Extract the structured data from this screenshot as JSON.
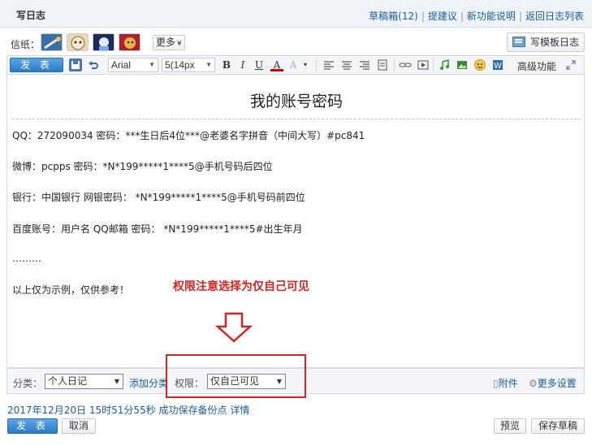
{
  "header": {
    "title": "写日志",
    "links": [
      "草稿箱(12)",
      "提建议",
      "新功能说明",
      "返回日志列表"
    ]
  },
  "stationery": {
    "label": "信纸：",
    "more_label": "更多",
    "template_label": "写模板日志"
  },
  "toolbar": {
    "publish_label": "发 表",
    "font_name": "Arial",
    "font_size": "5(14px",
    "advanced_label": "高级功能"
  },
  "doc": {
    "title": "我的账号密码",
    "lines": [
      "QQ：272090034 密码：***生日后4位***@老婆名字拼音（中间大写）#pc841",
      "微博：pcpps 密码：*N*199*****1****5@手机号码后四位",
      "银行：中国银行 网银密码： *N*199*****1****5@手机号码前四位",
      "百度账号：用户名 QQ邮箱 密码： *N*199*****1****5#出生年月",
      "………",
      "以上仅为示例，仅供参考！"
    ]
  },
  "annotation": {
    "text": "权限注意选择为仅自己可见",
    "color": "#d62424"
  },
  "options": {
    "category_label": "分类：",
    "category_value": "个人日记",
    "add_category": "添加分类",
    "permission_label": "权限：",
    "permission_value": "仅自己可见",
    "attachment": "附件",
    "more_settings": "更多设置"
  },
  "footer": {
    "status": "2017年12月20日 15时51分55秒 成功保存备份点 详情",
    "publish": "发 表",
    "cancel": "取消",
    "preview": "预览",
    "save_draft": "保存草稿"
  },
  "colors": {
    "link": "#1c5c9a",
    "accent": "#2b7bc6",
    "highlight": "#d62424"
  }
}
